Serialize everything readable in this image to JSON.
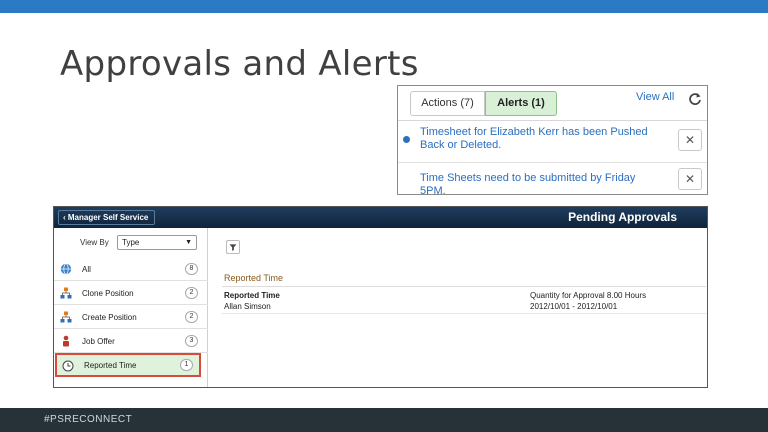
{
  "slide": {
    "title": "Approvals and Alerts",
    "footer": "#PSRECONNECT"
  },
  "colors": {
    "top_bar": "#2b7bc4",
    "footer_bg": "#263238",
    "link_blue": "#2a6fc0",
    "selected_highlight": "#d94a3a",
    "alerts_tab_bg": "#d8f1d6"
  },
  "alerts_panel": {
    "tabs": [
      {
        "label": "Actions (7)",
        "selected": false
      },
      {
        "label": "Alerts (1)",
        "selected": true
      }
    ],
    "view_all": "View All",
    "refresh_icon": "refresh-icon",
    "items": [
      {
        "text": "Timesheet for Elizabeth Kerr has been Pushed Back or Deleted.",
        "unread": true,
        "close": "✕"
      },
      {
        "text": "Time Sheets need to be submitted by Friday 5PM.",
        "unread": false,
        "close": "✕"
      }
    ]
  },
  "approvals_panel": {
    "back_button": "Manager Self Service",
    "title": "Pending Approvals",
    "view_by": {
      "label": "View By",
      "value": "Type"
    },
    "categories": [
      {
        "label": "All",
        "count": "8",
        "icon": "globe-icon"
      },
      {
        "label": "Clone Position",
        "count": "2",
        "icon": "org-chart-icon"
      },
      {
        "label": "Create Position",
        "count": "2",
        "icon": "org-chart-icon"
      },
      {
        "label": "Job Offer",
        "count": "3",
        "icon": "person-icon"
      },
      {
        "label": "Reported Time",
        "count": "1",
        "icon": "clock-icon",
        "selected": true
      }
    ],
    "filter_icon": "filter-icon",
    "section": "Reported Time",
    "rows": [
      {
        "title": "Reported Time",
        "name": "Allan Simson",
        "quantity": "Quantity for Approval 8.00 Hours",
        "dates": "2012/10/01 - 2012/10/01"
      }
    ]
  }
}
